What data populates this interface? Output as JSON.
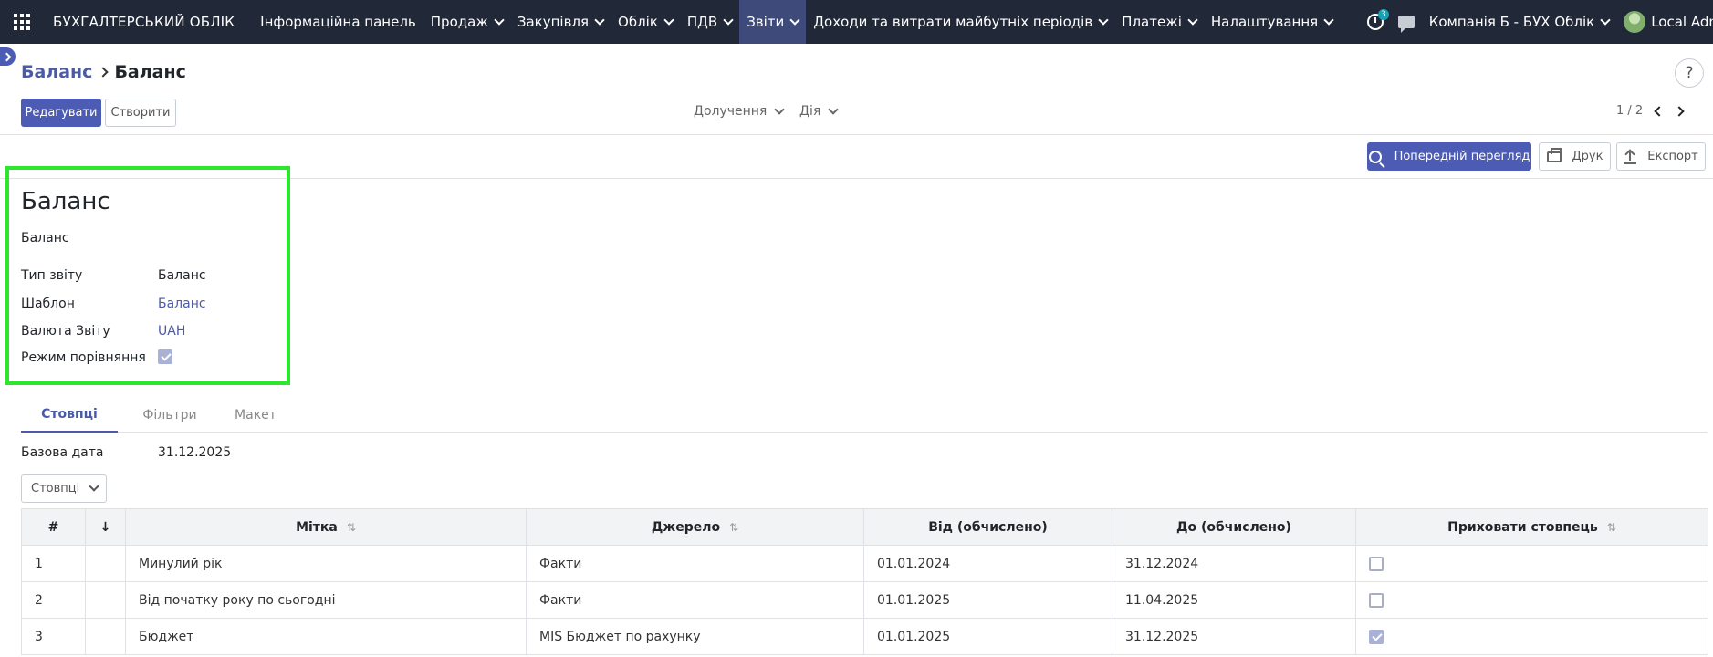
{
  "navbar": {
    "brand": "БУХГАЛТЕРСЬКИЙ ОБЛІК",
    "menu": [
      {
        "label": "Інформаційна панель",
        "dropdown": false
      },
      {
        "label": "Продаж",
        "dropdown": true
      },
      {
        "label": "Закупівля",
        "dropdown": true
      },
      {
        "label": "Облік",
        "dropdown": true
      },
      {
        "label": "ПДВ",
        "dropdown": true
      },
      {
        "label": "Звіти",
        "dropdown": true,
        "active": true
      },
      {
        "label": "Доходи та витрати майбутніх періодів",
        "dropdown": true
      },
      {
        "label": "Платежі",
        "dropdown": true
      },
      {
        "label": "Налаштування",
        "dropdown": true
      }
    ],
    "activity_badge": "3",
    "company": "Компанія Б - БУХ Облік",
    "user": "Local Adm"
  },
  "breadcrumb": {
    "parent": "Баланс",
    "current": "Баланс"
  },
  "control": {
    "edit_label": "Редагувати",
    "create_label": "Створити",
    "attach_label": "Долучення",
    "action_label": "Дія",
    "pager": "1 / 2",
    "help": "?"
  },
  "report_buttons": {
    "preview": "Попередній перегляд",
    "print": "Друк",
    "export": "Експорт"
  },
  "form": {
    "title": "Баланс",
    "subtitle": "Баланс",
    "fields": [
      {
        "label": "Тип звіту",
        "value": "Баланс"
      },
      {
        "label": "Шаблон",
        "value": "Баланс"
      },
      {
        "label": "Валюта Звіту",
        "value": "UAH"
      },
      {
        "label": "Режим порівняння",
        "checked": true
      }
    ]
  },
  "tabs": [
    "Стовпці",
    "Фільтри",
    "Макет"
  ],
  "base_date": {
    "label": "Базова дата",
    "value": "31.12.2025"
  },
  "columns_button": "Стовпці",
  "table": {
    "headers": [
      "#",
      "↓",
      "Мітка",
      "Джерело",
      "Від (обчислено)",
      "До (обчислено)",
      "Приховати стовпець"
    ],
    "rows": [
      {
        "num": "1",
        "label": "Минулий рік",
        "source": "Факти",
        "from": "01.01.2024",
        "to": "31.12.2024",
        "hidden": false
      },
      {
        "num": "2",
        "label": "Від початку року по сьогодні",
        "source": "Факти",
        "from": "01.01.2025",
        "to": "11.04.2025",
        "hidden": false
      },
      {
        "num": "3",
        "label": "Бюджет",
        "source": "MIS Бюджет по рахунку",
        "from": "01.01.2025",
        "to": "31.12.2025",
        "hidden": true
      }
    ]
  },
  "colors": {
    "navbar": "#212838",
    "primary": "#4c5bb3",
    "link": "#4b5aa8",
    "highlight": "#2ee62e"
  }
}
